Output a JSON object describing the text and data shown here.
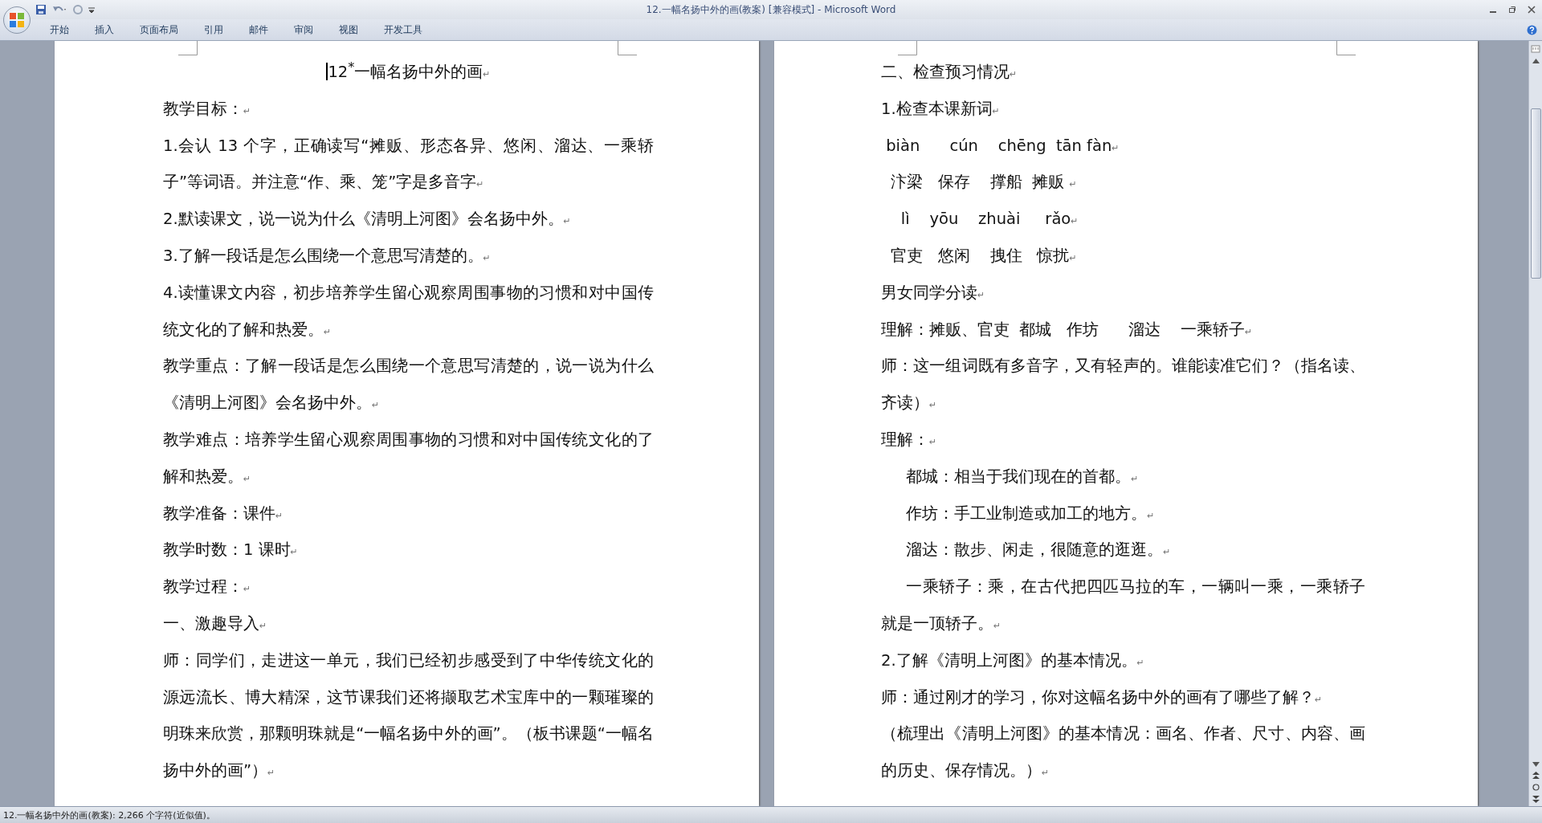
{
  "window": {
    "title": "12.一幅名扬中外的画(教案) [兼容模式] - Microsoft Word"
  },
  "ribbon_tabs": [
    {
      "label": "开始",
      "selected": false
    },
    {
      "label": "插入",
      "selected": false
    },
    {
      "label": "页面布局",
      "selected": false
    },
    {
      "label": "引用",
      "selected": false
    },
    {
      "label": "邮件",
      "selected": false
    },
    {
      "label": "审阅",
      "selected": false
    },
    {
      "label": "视图",
      "selected": false
    },
    {
      "label": "开发工具",
      "selected": false
    }
  ],
  "pages": [
    {
      "paragraphs": [
        {
          "kind": "title",
          "text": "12$^{*}$一幅名扬中外的画",
          "mark": "↵"
        },
        {
          "kind": "body",
          "text": "教学目标：",
          "mark": "↵"
        },
        {
          "kind": "body",
          "text": "1.会认 13 个字，正确读写“摊贩、形态各异、悠闲、溜达、一乘轿子”等词语。并注意“作、乘、笼”字是多音字",
          "mark": "↵"
        },
        {
          "kind": "body",
          "text": "2.默读课文，说一说为什么《清明上河图》会名扬中外。",
          "mark": "↵"
        },
        {
          "kind": "body",
          "text": "3.了解一段话是怎么围绕一个意思写清楚的。",
          "mark": "↵"
        },
        {
          "kind": "body",
          "text": "4.读懂课文内容，初步培养学生留心观察周围事物的习惯和对中国传统文化的了解和热爱。",
          "mark": "↵"
        },
        {
          "kind": "body",
          "text": "教学重点：了解一段话是怎么围绕一个意思写清楚的，说一说为什么《清明上河图》会名扬中外。",
          "mark": "↵"
        },
        {
          "kind": "body",
          "text": "教学难点：培养学生留心观察周围事物的习惯和对中国传统文化的了解和热爱。",
          "mark": "↵"
        },
        {
          "kind": "body",
          "text": "教学准备：课件",
          "mark": "↵"
        },
        {
          "kind": "body",
          "text": "教学时数：1 课时",
          "mark": "↵"
        },
        {
          "kind": "body",
          "text": "教学过程：",
          "mark": "↵"
        },
        {
          "kind": "body",
          "text": "一、激趣导入",
          "mark": "↵"
        },
        {
          "kind": "body",
          "text": "师：同学们，走进这一单元，我们已经初步感受到了中华传统文化的源远流长、博大精深，这节课我们还将撷取艺术宝库中的一颗璀璨的明珠来欣赏，那颗明珠就是“一幅名扬中外的画”。（板书课题“一幅名扬中外的画”）",
          "mark": "↵"
        }
      ]
    },
    {
      "paragraphs": [
        {
          "kind": "body",
          "text": "二、检查预习情况",
          "mark": "↵"
        },
        {
          "kind": "body",
          "text": "1.检查本课新词",
          "mark": "↵"
        },
        {
          "kind": "pre",
          "text": " biàn      cún    chēng  tān fàn",
          "mark": "↵"
        },
        {
          "kind": "pre",
          "text": "  汴梁   保存    撑船  摊贩 ",
          "mark": "↵"
        },
        {
          "kind": "pre",
          "text": "    lì    yōu    zhuài     rǎo",
          "mark": "↵"
        },
        {
          "kind": "pre",
          "text": "  官吏   悠闲    拽住   惊扰",
          "mark": "↵"
        },
        {
          "kind": "body",
          "text": "男女同学分读",
          "mark": "↵"
        },
        {
          "kind": "pre",
          "text": "理解：摊贩、官吏  都城   作坊      溜达    一乘轿子",
          "mark": "↵"
        },
        {
          "kind": "body",
          "text": "师：这一组词既有多音字，又有轻声的。谁能读准它们？（指名读、齐读）",
          "mark": "↵"
        },
        {
          "kind": "body",
          "text": "理解：",
          "mark": "↵"
        },
        {
          "kind": "indent",
          "text": "都城：相当于我们现在的首都。",
          "mark": "↵"
        },
        {
          "kind": "indent",
          "text": "作坊：手工业制造或加工的地方。",
          "mark": "↵"
        },
        {
          "kind": "indent",
          "text": "溜达：散步、闲走，很随意的逛逛。",
          "mark": "↵"
        },
        {
          "kind": "indent",
          "text": "一乘轿子：乘，在古代把四匹马拉的车，一辆叫一乘，一乘轿子就是一顶轿子。",
          "mark": "↵"
        },
        {
          "kind": "body",
          "text": "2.了解《清明上河图》的基本情况。",
          "mark": "↵"
        },
        {
          "kind": "body",
          "text": "师：通过刚才的学习，你对这幅名扬中外的画有了哪些了解？",
          "mark": "↵"
        },
        {
          "kind": "body",
          "text": "（梳理出《清明上河图》的基本情况：画名、作者、尺寸、内容、画的历史、保存情况。）",
          "mark": "↵"
        }
      ]
    }
  ],
  "status_bar": {
    "text": "12.一幅名扬中外的画(教案): 2,266 个字符(近似值)。"
  }
}
